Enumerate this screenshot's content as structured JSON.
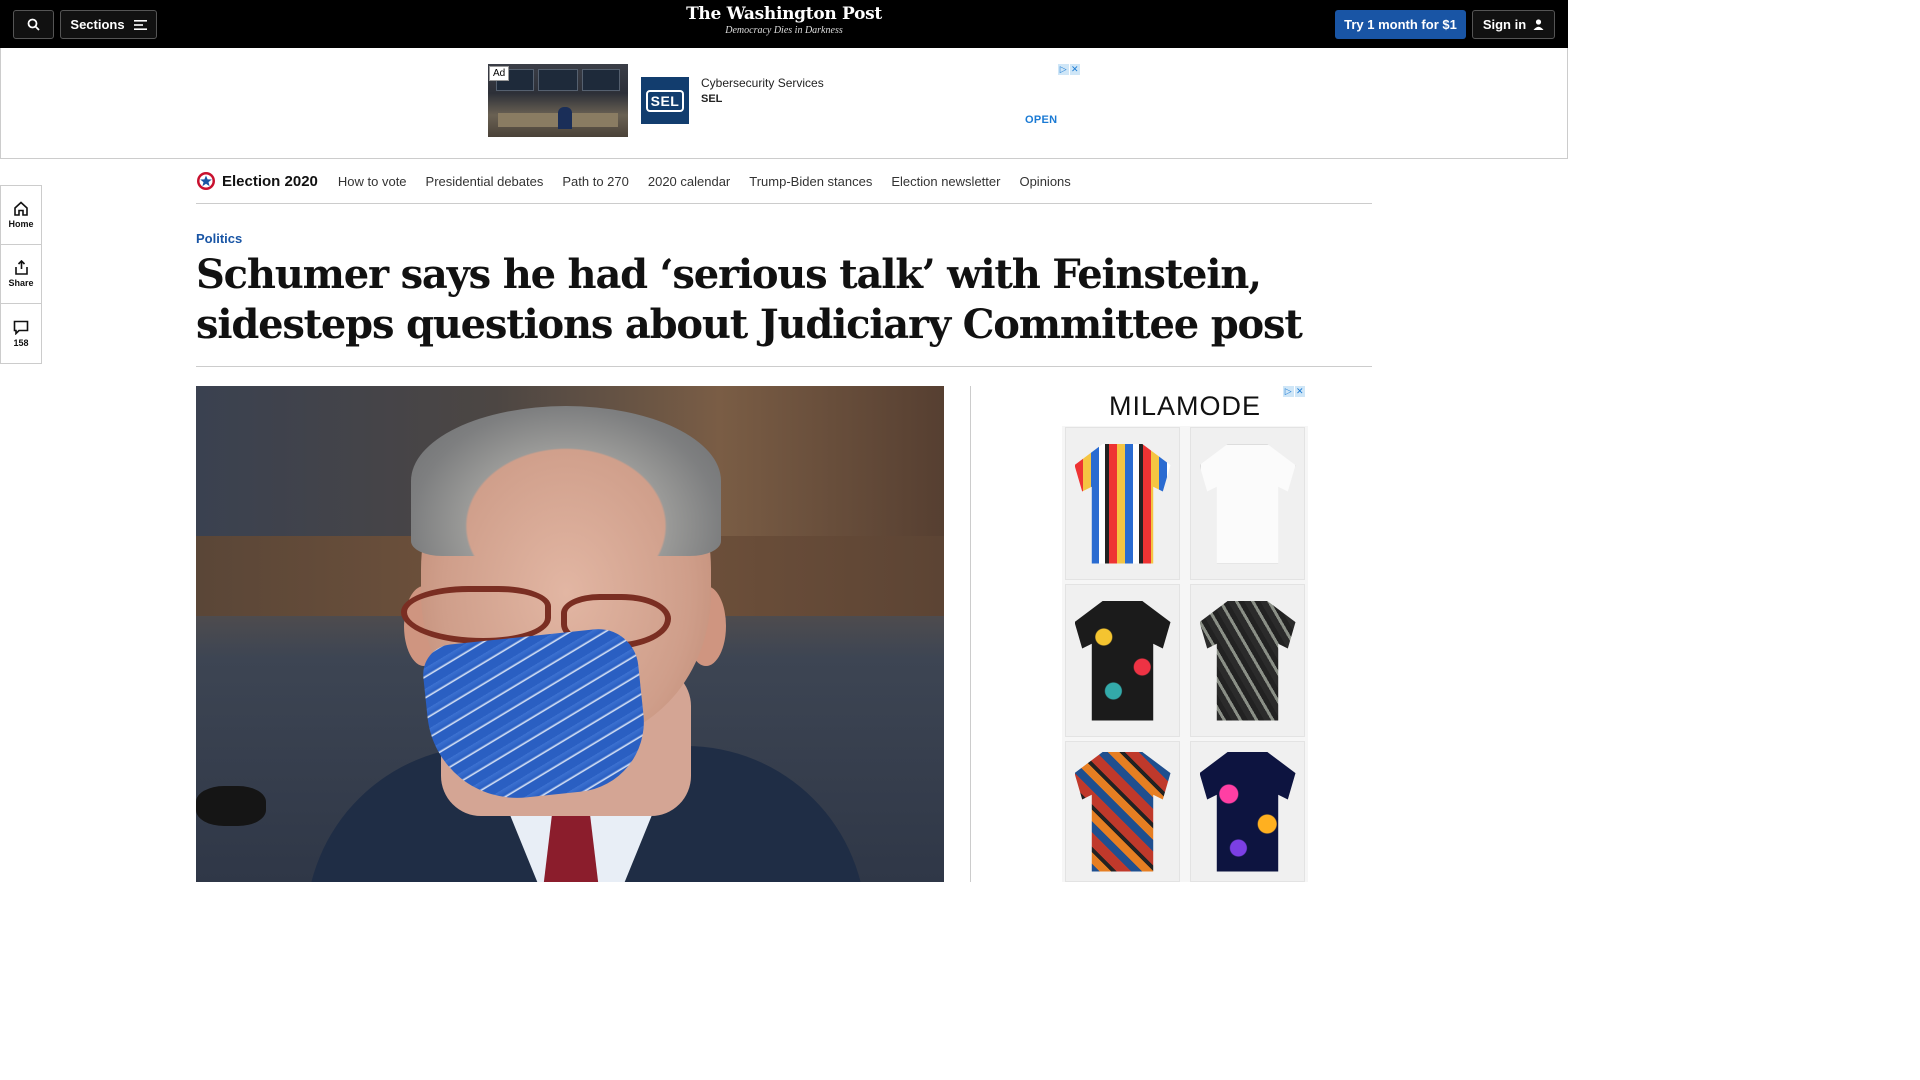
{
  "topbar": {
    "sections_label": "Sections",
    "logo": "The Washington Post",
    "tagline": "Democracy Dies in Darkness",
    "subscribe_label": "Try 1 month for $1",
    "signin_label": "Sign in"
  },
  "banner_ad": {
    "ad_label": "Ad",
    "title": "Cybersecurity Services",
    "brand": "SEL",
    "logo_text": "SEL",
    "cta": "OPEN"
  },
  "rail": {
    "home": "Home",
    "share": "Share",
    "comments_count": "158"
  },
  "election_nav": {
    "title": "Election 2020",
    "links": [
      "How to vote",
      "Presidential debates",
      "Path to 270",
      "2020 calendar",
      "Trump-Biden stances",
      "Election newsletter",
      "Opinions"
    ]
  },
  "article": {
    "kicker": "Politics",
    "headline": "Schumer says he had ‘serious talk’ with Feinstein, sidesteps questions about Judiciary Committee post"
  },
  "side_ad": {
    "brand": "MILAMODE"
  },
  "colors": {
    "accent_blue": "#1955a5",
    "topbar_bg": "#000000"
  }
}
